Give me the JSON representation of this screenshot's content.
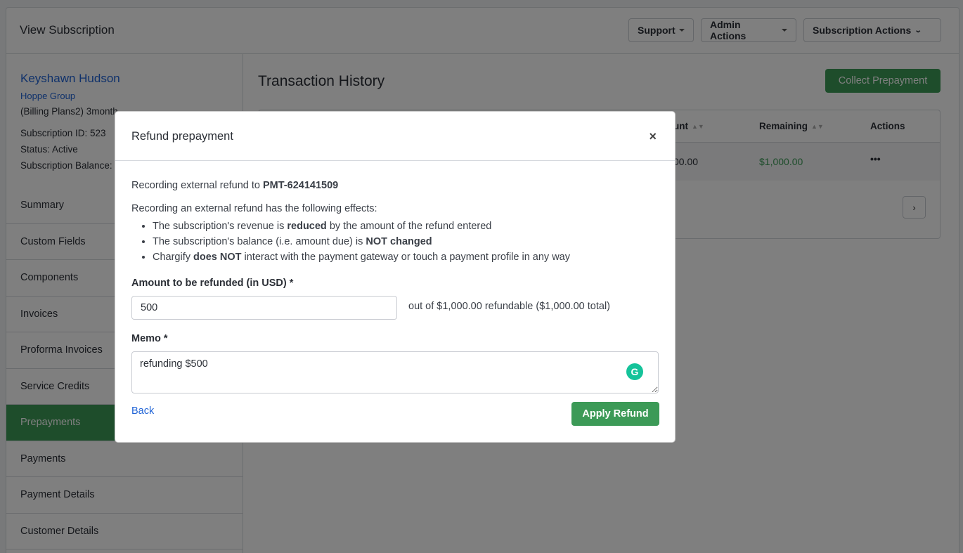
{
  "header": {
    "title": "View Subscription",
    "buttons": {
      "support": "Support",
      "admin": "Admin Actions",
      "subscription": "Subscription Actions"
    }
  },
  "customer": {
    "name": "Keyshawn Hudson",
    "org": "Hoppe Group",
    "plan": "(Billing Plans2) 3month",
    "subscription_id": "Subscription ID: 523",
    "status": "Status: Active",
    "balance": "Subscription Balance:"
  },
  "sidebar": {
    "items": [
      {
        "label": "Summary"
      },
      {
        "label": "Custom Fields"
      },
      {
        "label": "Components"
      },
      {
        "label": "Invoices"
      },
      {
        "label": "Proforma Invoices"
      },
      {
        "label": "Service Credits"
      },
      {
        "label": "Prepayments",
        "active": true
      },
      {
        "label": "Payments"
      },
      {
        "label": "Payment Details"
      },
      {
        "label": "Customer Details"
      }
    ]
  },
  "main": {
    "title": "Transaction History",
    "collect_button": "Collect Prepayment",
    "columns": {
      "amount": "unt",
      "remaining": "Remaining",
      "actions": "Actions"
    },
    "row": {
      "amount": "00.00",
      "remaining": "$1,000.00",
      "actions_icon": "•••"
    },
    "pager_icon": "›"
  },
  "modal": {
    "title": "Refund prepayment",
    "close_icon": "×",
    "recording_prefix": "Recording external refund to ",
    "payment_id": "PMT-624141509",
    "effects_intro": "Recording an external refund has the following effects:",
    "effects": [
      {
        "pre": "The subscription's revenue is ",
        "bold": "reduced",
        "post": " by the amount of the refund entered"
      },
      {
        "pre": "The subscription's balance (i.e. amount due) is ",
        "bold": "NOT changed",
        "post": ""
      },
      {
        "pre": "Chargify ",
        "bold": "does NOT",
        "post": " interact with the payment gateway or touch a payment profile in any way"
      }
    ],
    "amount_label": "Amount to be refunded (in USD) *",
    "amount_value": "500",
    "amount_note": "out of $1,000.00 refundable ($1,000.00 total)",
    "memo_label": "Memo *",
    "memo_value": "refunding $500",
    "grammarly_icon": "G",
    "back_link": "Back",
    "apply_button": "Apply Refund"
  },
  "colors": {
    "accent_green": "#3c9a57",
    "link_blue": "#1f63d6",
    "grammarly": "#15c39a"
  }
}
